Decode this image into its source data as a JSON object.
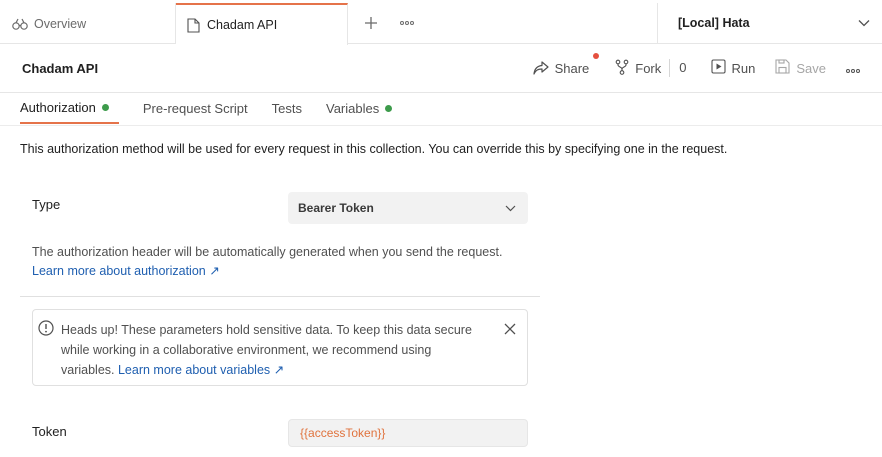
{
  "tabs": {
    "overview_label": "Overview",
    "active_label": "Chadam API",
    "new_tab_icon": "plus-icon",
    "more_icon": "ellipsis-icon"
  },
  "environment": {
    "selected": "[Local] Hata"
  },
  "header": {
    "title": "Chadam API",
    "share_label": "Share",
    "fork_label": "Fork",
    "fork_count": "0",
    "run_label": "Run",
    "save_label": "Save"
  },
  "subtabs": {
    "authorization": "Authorization",
    "prerequest": "Pre-request Script",
    "tests": "Tests",
    "variables": "Variables"
  },
  "auth": {
    "info": "This authorization method will be used for every request in this collection. You can override this by specifying one in the request.",
    "type_label": "Type",
    "type_value": "Bearer Token",
    "description": "The authorization header will be automatically generated when you send the request.",
    "learn_more": "Learn more about authorization ↗",
    "alert_text": "Heads up! These parameters hold sensitive data. To keep this data secure while working in a collaborative environment, we recommend using variables.",
    "alert_link": "Learn more about variables ↗",
    "token_label": "Token",
    "token_value": "{{accessToken}}"
  },
  "colors": {
    "accent": "#e5734a",
    "status_green": "#3d9b4b",
    "notify_red": "#e5503f",
    "link": "#1f5fb0",
    "variable": "#e0733e"
  }
}
